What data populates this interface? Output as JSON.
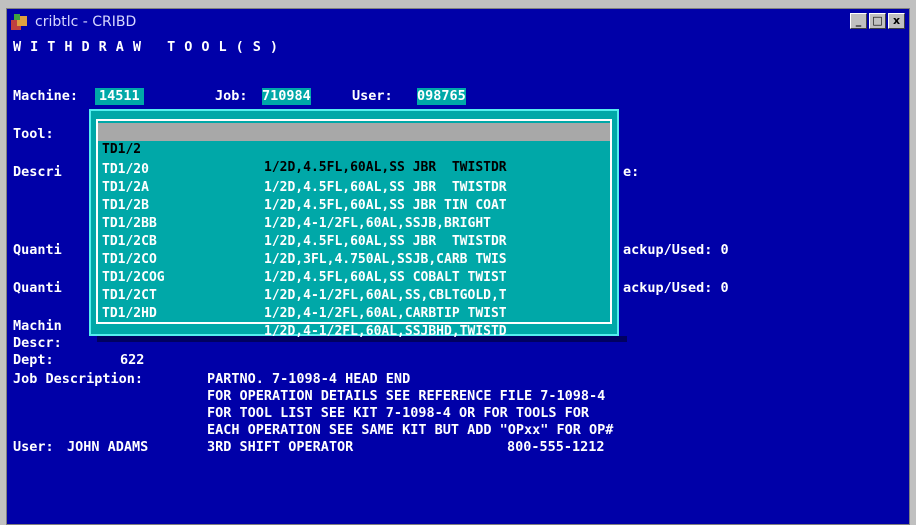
{
  "window": {
    "title": "cribtlc - CRIBD",
    "buttons": {
      "minimize": "_",
      "maximize": "□",
      "close": "x"
    }
  },
  "screen": {
    "heading": "WITHDRAW TOOL(S)",
    "machine_label": "Machine:",
    "machine_value": "14511",
    "job_label": "Job:",
    "job_value": "710984",
    "user_label": "User:",
    "user_value": "098765",
    "tool_label": "Tool:",
    "descr_label_partial": "Descri",
    "descr_suffix": "e:",
    "quantity_label_partial_1": "Quanti",
    "backup_used_1": "ackup/Used: 0",
    "quantity_label_partial_2": "Quanti",
    "backup_used_2": "ackup/Used: 0",
    "machine_label_partial": "Machin",
    "descr_label": "Descr:",
    "dept_label": "Dept:",
    "dept_value": "622",
    "job_description_label": "Job Description:",
    "job_description_lines": [
      "PARTNO. 7-1098-4 HEAD END",
      "FOR OPERATION DETAILS SEE REFERENCE FILE 7-1098-4",
      "FOR TOOL LIST SEE KIT 7-1098-4 OR FOR TOOLS FOR",
      "EACH OPERATION SEE SAME KIT BUT ADD \"OPxx\" FOR OP#"
    ],
    "user_line_label": "User:",
    "user_line_name": "JOHN ADAMS",
    "user_line_role": "3RD SHIFT OPERATOR",
    "user_line_phone": "800-555-1212"
  },
  "tool_list": [
    {
      "code": "TD1/2",
      "desc": "1/2D,4.5FL,60AL,SS JBR  TWISTDR",
      "selected": true
    },
    {
      "code": "TD1/20",
      "desc": "1/2D,4.5FL,60AL,SS JBR  TWISTDR",
      "selected": false
    },
    {
      "code": "TD1/2A",
      "desc": "1/2D,4.5FL,60AL,SS JBR TIN COAT",
      "selected": false
    },
    {
      "code": "TD1/2B",
      "desc": "1/2D,4-1/2FL,60AL,SSJB,BRIGHT",
      "selected": false
    },
    {
      "code": "TD1/2BB",
      "desc": "1/2D,4.5FL,60AL,SS JBR  TWISTDR",
      "selected": false
    },
    {
      "code": "TD1/2CB",
      "desc": "1/2D,3FL,4.750AL,SSJB,CARB TWIS",
      "selected": false
    },
    {
      "code": "TD1/2CO",
      "desc": "1/2D,4.5FL,60AL,SS COBALT TWIST",
      "selected": false
    },
    {
      "code": "TD1/2COG",
      "desc": "1/2D,4-1/2FL,60AL,SS,CBLTGOLD,T",
      "selected": false
    },
    {
      "code": "TD1/2CT",
      "desc": "1/2D,4-1/2FL,60AL,CARBTIP TWIST",
      "selected": false
    },
    {
      "code": "TD1/2HD",
      "desc": "1/2D,4-1/2FL,60AL,SSJBHD,TWISTD",
      "selected": false
    }
  ],
  "colors": {
    "background": "#0000a8",
    "highlight": "#00a8a8",
    "selection": "#a8a8a8"
  }
}
